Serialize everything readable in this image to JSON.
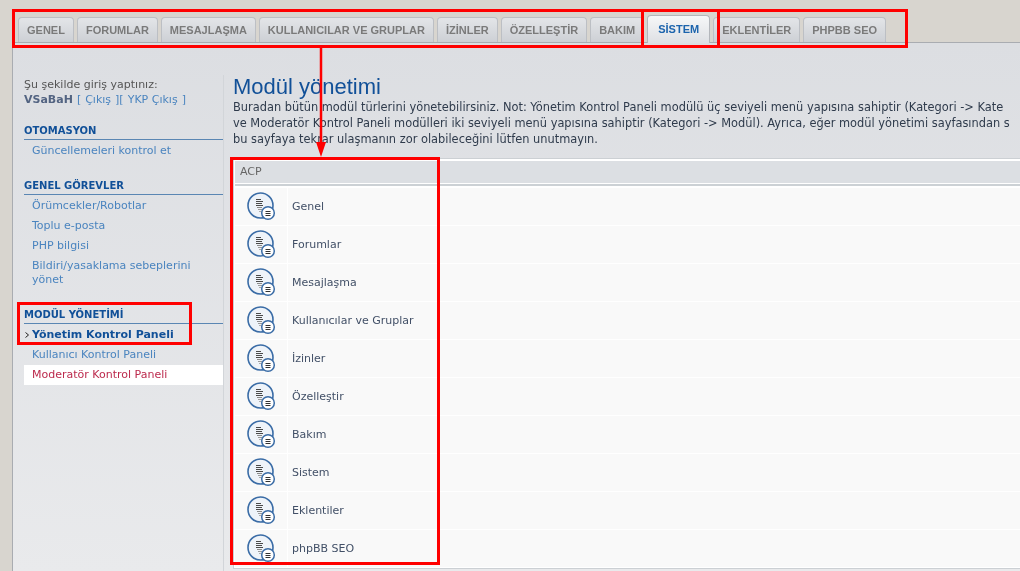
{
  "tabs": [
    {
      "label": "GENEL",
      "selected": false
    },
    {
      "label": "FORUMLAR",
      "selected": false
    },
    {
      "label": "MESAJLAŞMA",
      "selected": false
    },
    {
      "label": "KULLANICILAR VE GRUPLAR",
      "selected": false
    },
    {
      "label": "İZİNLER",
      "selected": false
    },
    {
      "label": "ÖZELLEŞTİR",
      "selected": false
    },
    {
      "label": "BAKIM",
      "selected": false
    },
    {
      "label": "SİSTEM",
      "selected": true
    },
    {
      "label": "EKLENTİLER",
      "selected": false
    },
    {
      "label": "PHPBB SEO",
      "selected": false
    }
  ],
  "sidebar": {
    "login_label": "Şu şekilde giriş yaptınız:",
    "login_line": [
      {
        "kind": "user",
        "text": "VSaBaH"
      },
      {
        "kind": "bracket",
        "text": "["
      },
      {
        "kind": "link",
        "text": "Çıkış"
      },
      {
        "kind": "bracket",
        "text": "]["
      },
      {
        "kind": "link",
        "text": "YKP Çıkış"
      },
      {
        "kind": "bracket",
        "text": "]"
      }
    ],
    "sections": [
      {
        "title": "OTOMASYON",
        "items": [
          {
            "label": "Güncellemeleri kontrol et",
            "selected": false,
            "hovered": false
          }
        ]
      },
      {
        "title": "GENEL GÖREVLER",
        "items": [
          {
            "label": "Örümcekler/Robotlar",
            "selected": false,
            "hovered": false
          },
          {
            "label": "Toplu e-posta",
            "selected": false,
            "hovered": false
          },
          {
            "label": "PHP bilgisi",
            "selected": false,
            "hovered": false
          },
          {
            "label": "Bildiri/yasaklama sebeplerini yönet",
            "selected": false,
            "hovered": false
          }
        ]
      },
      {
        "title": "MODÜL YÖNETİMİ",
        "items": [
          {
            "label": "Yönetim Kontrol Paneli",
            "selected": true,
            "hovered": false
          },
          {
            "label": "Kullanıcı Kontrol Paneli",
            "selected": false,
            "hovered": false
          },
          {
            "label": "Moderatör Kontrol Paneli",
            "selected": false,
            "hovered": true
          }
        ]
      }
    ]
  },
  "main": {
    "title": "Modül yönetimi",
    "description_lines": [
      "Buradan bütün modül türlerini yönetebilirsiniz. Not: Yönetim Kontrol Paneli modülü üç seviyeli menü yapısına sahiptir (Kategori -> Kate",
      "ve Moderatör Kontrol Paneli modülleri iki seviyeli menü yapısına sahiptir (Kategori -> Modül). Ayrıca, eğer modül yönetimi sayfasından s",
      "bu sayfaya tekrar ulaşmanın zor olabileceğini lütfen unutmayın."
    ],
    "table": {
      "header": "ACP",
      "rows": [
        {
          "label": "Genel"
        },
        {
          "label": "Forumlar"
        },
        {
          "label": "Mesajlaşma"
        },
        {
          "label": "Kullanıcılar ve Gruplar"
        },
        {
          "label": "İzinler"
        },
        {
          "label": "Özelleştir"
        },
        {
          "label": "Bakım"
        },
        {
          "label": "Sistem"
        },
        {
          "label": "Eklentiler"
        },
        {
          "label": "phpBB SEO"
        }
      ]
    }
  }
}
